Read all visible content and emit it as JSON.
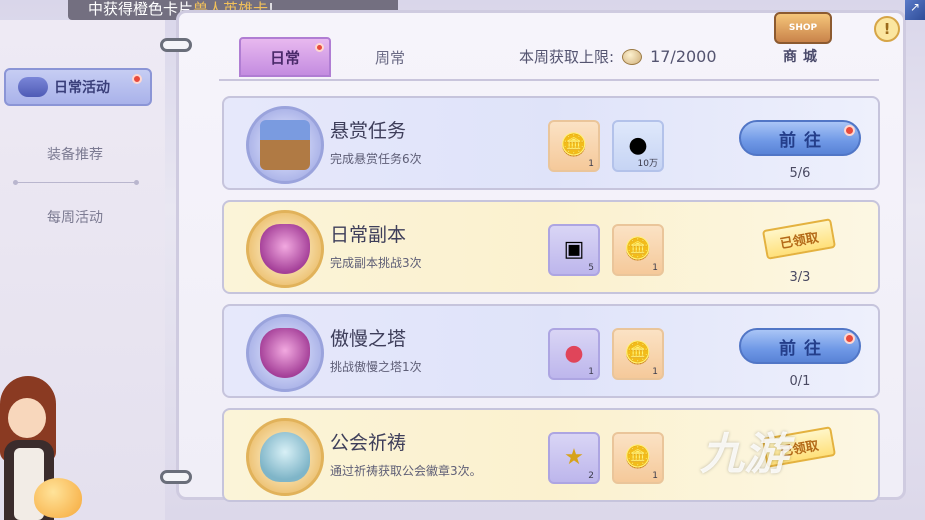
{
  "banner": {
    "prefix": "中获得橙色卡片",
    "highlight": "兽人英雄卡",
    "suffix": "!"
  },
  "sidebar": {
    "items": [
      {
        "label": "日常活动",
        "active": true,
        "badge": true
      },
      {
        "label": "装备推荐",
        "active": false
      },
      {
        "label": "每周活动",
        "active": false
      }
    ]
  },
  "tabs": [
    {
      "label": "日常",
      "active": true,
      "badge": true
    },
    {
      "label": "周常",
      "active": false
    }
  ],
  "weekly_limit": {
    "label": "本周获取上限:",
    "value": "17/2000"
  },
  "shop": {
    "sign": "SHOP",
    "label": "商城"
  },
  "help": {
    "label": "!"
  },
  "tasks": [
    {
      "title": "悬赏任务",
      "desc": "完成悬赏任务6次",
      "theme": "blue",
      "emblem": "notice-board-icon",
      "rewards": [
        {
          "icon": "medal-coin-icon",
          "count": "1",
          "bg": "orange"
        },
        {
          "icon": "gold-coin-icon",
          "count": "10万",
          "bg": "blue"
        }
      ],
      "action": "前往",
      "claimed": false,
      "badge": true,
      "progress": "5/6"
    },
    {
      "title": "日常副本",
      "desc": "完成副本挑战3次",
      "theme": "gold",
      "emblem": "demon-mask-icon",
      "rewards": [
        {
          "icon": "treasure-chest-icon",
          "count": "5",
          "bg": "purple"
        },
        {
          "icon": "medal-coin-icon",
          "count": "1",
          "bg": "orange"
        }
      ],
      "action": "已领取",
      "claimed": true,
      "badge": false,
      "progress": "3/3"
    },
    {
      "title": "傲慢之塔",
      "desc": "挑战傲慢之塔1次",
      "theme": "blue",
      "emblem": "demon-mask-icon",
      "rewards": [
        {
          "icon": "red-potion-icon",
          "count": "1",
          "bg": "purple"
        },
        {
          "icon": "medal-coin-icon",
          "count": "1",
          "bg": "orange"
        }
      ],
      "action": "前往",
      "claimed": false,
      "badge": true,
      "progress": "0/1"
    },
    {
      "title": "公会祈祷",
      "desc": "通过祈祷获取公会徽章3次。",
      "theme": "gold",
      "emblem": "angel-emblem-icon",
      "rewards": [
        {
          "icon": "star-badge-icon",
          "count": "2",
          "bg": "purple"
        },
        {
          "icon": "medal-coin-icon",
          "count": "1",
          "bg": "orange"
        }
      ],
      "action": "已领取",
      "claimed": true,
      "badge": false,
      "progress": ""
    }
  ],
  "watermark": "九游"
}
